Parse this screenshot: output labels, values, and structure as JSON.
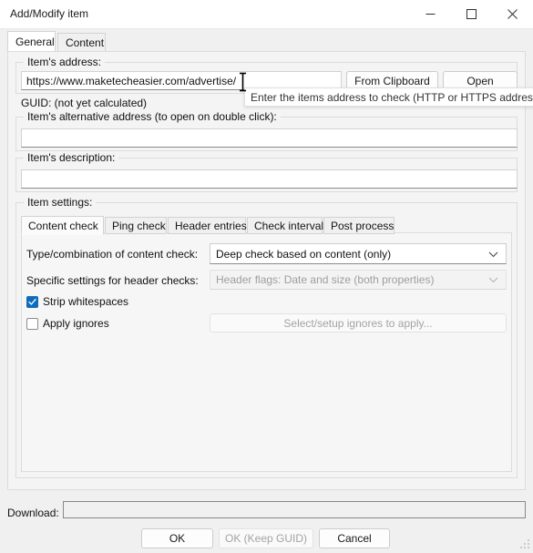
{
  "window": {
    "title": "Add/Modify item",
    "controls": {
      "minimize": "minimize-icon",
      "maximize": "maximize-icon",
      "close": "close-icon"
    }
  },
  "top_tabs": [
    {
      "label": "General",
      "selected": true
    },
    {
      "label": "Content",
      "selected": false
    }
  ],
  "address_group": {
    "title": "Item's address:",
    "value": "https://www.maketecheasier.com/advertise/",
    "placeholder": "",
    "from_clipboard_label": "From Clipboard",
    "open_label": "Open"
  },
  "tooltip": {
    "text": "Enter the items address to check (HTTP or HTTPS addresses"
  },
  "guid": {
    "label": "GUID: (not yet calculated)"
  },
  "alt_address_group": {
    "title": "Item's alternative address (to open on double click):",
    "value": "",
    "placeholder": ""
  },
  "description_group": {
    "title": "Item's description:",
    "value": "",
    "placeholder": ""
  },
  "item_settings": {
    "title": "Item settings:",
    "tabs": [
      {
        "label": "Content check",
        "selected": true
      },
      {
        "label": "Ping check",
        "selected": false
      },
      {
        "label": "Header entries",
        "selected": false
      },
      {
        "label": "Check interval",
        "selected": false
      },
      {
        "label": "Post process",
        "selected": false
      }
    ],
    "type_label": "Type/combination of content check:",
    "type_value": "Deep check based on content (only)",
    "header_label": "Specific settings for header checks:",
    "header_value": "Header flags: Date and size (both properties)",
    "strip_whitespaces": {
      "label": "Strip whitespaces",
      "checked": true
    },
    "apply_ignores": {
      "label": "Apply ignores",
      "checked": false
    },
    "ignores_button_label": "Select/setup ignores to apply..."
  },
  "footer": {
    "download_label": "Download:",
    "download_value": "",
    "ok_label": "OK",
    "ok_keep_guid_label": "OK (Keep GUID)",
    "cancel_label": "Cancel"
  },
  "colors": {
    "accent": "#0f6cbd",
    "window_bg": "#f0f0f0",
    "panel_bg": "#f4f4f4",
    "field_bg": "#ffffff",
    "text": "#111111",
    "disabled_text": "#a3a3a3"
  }
}
